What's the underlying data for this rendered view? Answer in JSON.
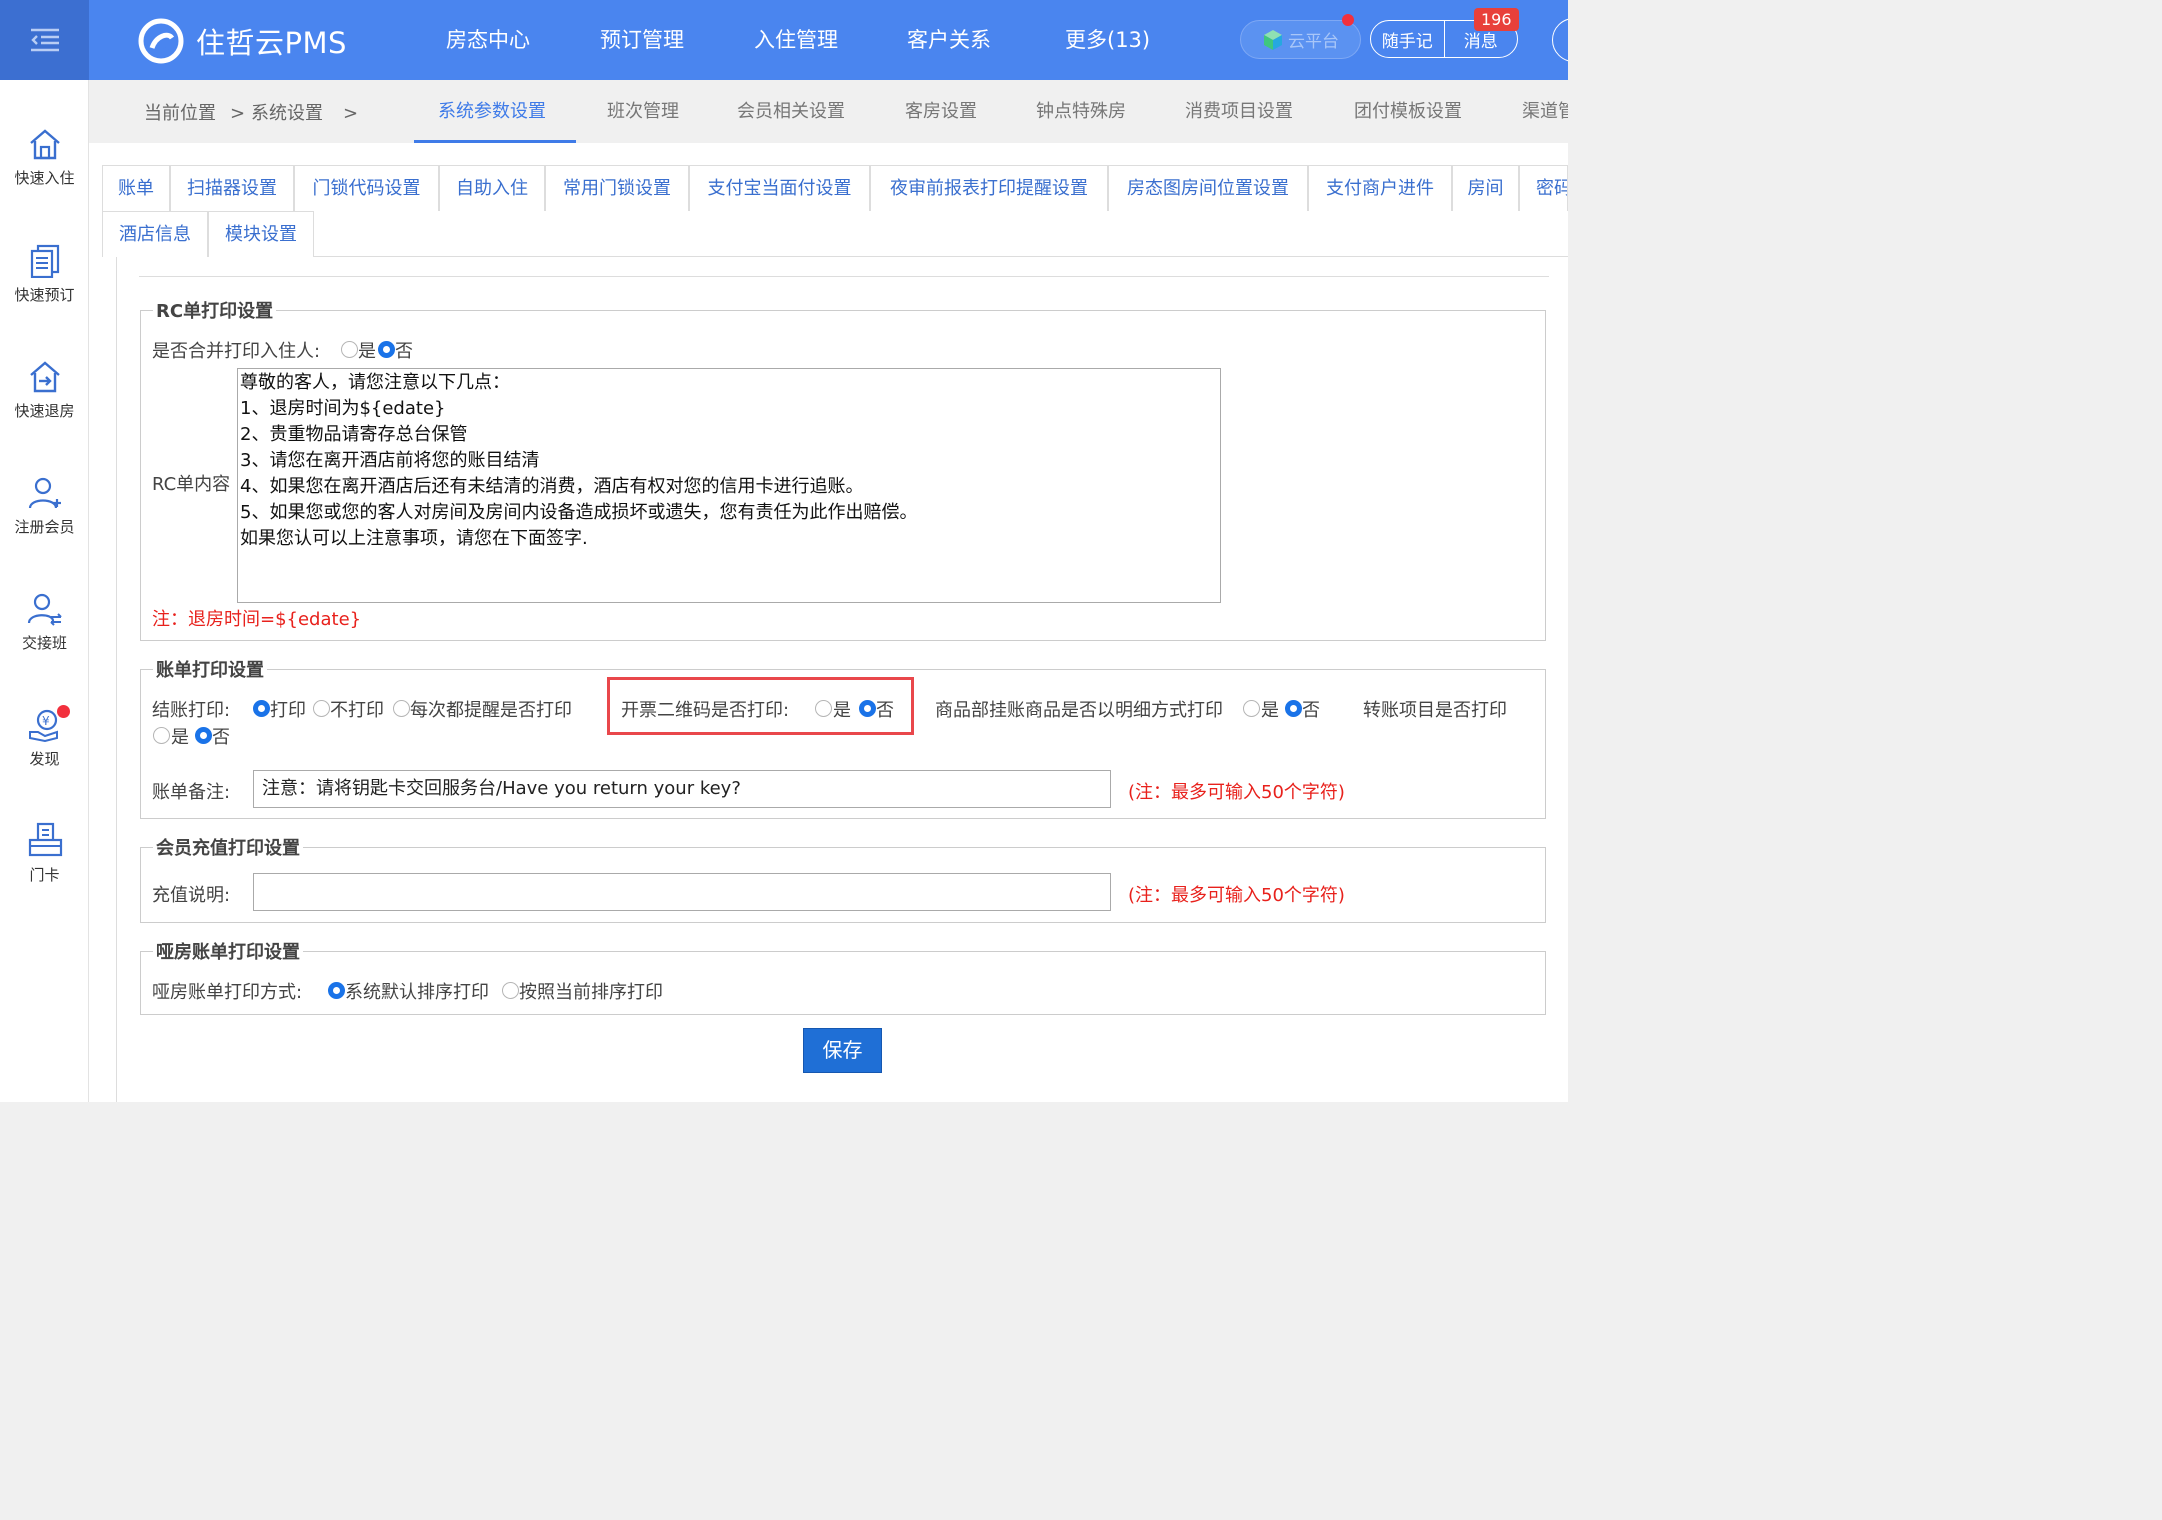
{
  "topbar": {
    "logo_text": "住哲云PMS",
    "nav": [
      "房态中心",
      "预订管理",
      "入住管理",
      "客户关系",
      "更多(13)"
    ],
    "cloud_label": "云平台",
    "notes_label": "随手记",
    "messages_label": "消息",
    "message_count": "196"
  },
  "sidebar": [
    {
      "label": "快速入住",
      "icon": "home-icon"
    },
    {
      "label": "快速预订",
      "icon": "document-icon"
    },
    {
      "label": "快速退房",
      "icon": "checkout-icon"
    },
    {
      "label": "注册会员",
      "icon": "add-user-icon"
    },
    {
      "label": "交接班",
      "icon": "shift-handover-icon"
    },
    {
      "label": "发现",
      "icon": "discover-icon"
    },
    {
      "label": "门卡",
      "icon": "door-card-icon"
    }
  ],
  "breadcrumb": {
    "current": "当前位置",
    "sep": ">",
    "section": "系统设置"
  },
  "main_tabs": [
    "系统参数设置",
    "班次管理",
    "会员相关设置",
    "客房设置",
    "钟点特殊房",
    "消费项目设置",
    "团付模板设置",
    "渠道管"
  ],
  "sub_tabs": [
    "账单",
    "扫描器设置",
    "门锁代码设置",
    "自助入住",
    "常用门锁设置",
    "支付宝当面付设置",
    "夜审前报表打印提醒设置",
    "房态图房间位置设置",
    "支付商户进件",
    "房间",
    "密码",
    "酒店信息",
    "模块设置"
  ],
  "rc": {
    "legend": "RC单打印设置",
    "merge_label": "是否合并打印入住人:",
    "yes": "是",
    "no": "否",
    "merge_value": "否",
    "content_label": "RC单内容",
    "content": "尊敬的客人，请您注意以下几点：\n1、退房时间为${edate}\n2、贵重物品请寄存总台保管\n3、请您在离开酒店前将您的账目结清\n4、如果您在离开酒店后还有未结清的消费，酒店有权对您的信用卡进行追账。\n5、如果您或您的客人对房间及房间内设备造成损坏或遗失，您有责任为此作出赔偿。\n如果您认可以上注意事项，请您在下面签字.",
    "note": "注：退房时间=${edate}"
  },
  "bill": {
    "legend": "账单打印设置",
    "checkout_label": "结账打印:",
    "checkout_options": [
      "打印",
      "不打印",
      "每次都提醒是否打印"
    ],
    "checkout_value": "打印",
    "invoice_qr_label": "开票二维码是否打印:",
    "invoice_qr_value": "否",
    "goods_detail_label": "商品部挂账商品是否以明细方式打印",
    "goods_detail_value": "否",
    "transfer_label": "转账项目是否打印",
    "transfer_value": "否",
    "yes": "是",
    "no": "否",
    "remark_label": "账单备注:",
    "remark_value": "注意：请将钥匙卡交回服务台/Have you return your key?",
    "limit_note": "(注：最多可输入50个字符)"
  },
  "recharge": {
    "legend": "会员充值打印设置",
    "desc_label": "充值说明:",
    "desc_value": "",
    "limit_note": "(注：最多可输入50个字符)"
  },
  "mute": {
    "legend": "哑房账单打印设置",
    "mode_label": "哑房账单打印方式:",
    "options": [
      "系统默认排序打印",
      "按照当前排序打印"
    ],
    "value": "系统默认排序打印"
  },
  "save_label": "保存",
  "colors": {
    "primary": "#4a85ef",
    "link": "#3a6fcf",
    "warning": "#e8211c",
    "highlight": "#e9474b"
  }
}
